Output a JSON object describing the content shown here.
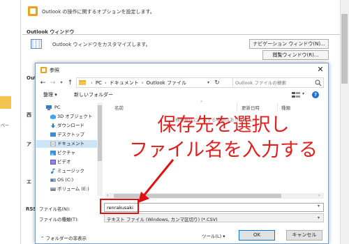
{
  "background": {
    "header_text": "Outlook の操作に関するオプションを設定します。",
    "section_title": "Outlook ウィンドウ",
    "customize_text": "Outlook ウィンドウをカスタマイズします。",
    "nav_window_button": "ナビゲーション ウィンドウ(N)...",
    "reading_window_button": "閲覧ウィンドウ(R)...",
    "sidebar_text": "ベー",
    "side_labels": [
      "Out",
      "西",
      "ア",
      "エ",
      "RSS"
    ]
  },
  "dialog": {
    "title": "参照",
    "close_glyph": "✕",
    "breadcrumbs": [
      "PC",
      "ドキュメント",
      "Outlook ファイル"
    ],
    "breadcrumb_sep": "›",
    "search_placeholder": "Outlook ファイルの検索",
    "organize_label": "整理 ▾",
    "new_folder_label": "新しいフォルダー",
    "nav_items": [
      {
        "label": "PC",
        "icon": "pc-icon"
      },
      {
        "label": "3D オブジェクト",
        "icon": "3d-objects-icon"
      },
      {
        "label": "ダウンロード",
        "icon": "download-icon"
      },
      {
        "label": "デスクトップ",
        "icon": "desktop-icon"
      },
      {
        "label": "ドキュメント",
        "icon": "documents-icon",
        "selected": true
      },
      {
        "label": "ピクチャ",
        "icon": "pictures-icon"
      },
      {
        "label": "ビデオ",
        "icon": "video-icon"
      },
      {
        "label": "ミュージック",
        "icon": "music-icon"
      },
      {
        "label": "OS (C:)",
        "icon": "drive-icon"
      },
      {
        "label": "ボリューム (E:)",
        "icon": "drive-icon"
      }
    ],
    "columns": {
      "name": "名前",
      "date": "更新日時",
      "type": "種類"
    },
    "empty_message": "検索条件に一致する項目はありません。",
    "filename_label": "ファイル名(N):",
    "filename_value": "renrakusaki",
    "filetype_label": "ファイルの種類(T):",
    "filetype_value": "テキスト ファイル (Windows, カンマ区切り) (*.CSV)",
    "hide_folders_label": "フォルダーの非表示",
    "tools_label": "ツール(L) ▾",
    "ok_label": "OK",
    "cancel_label": "キャンセル"
  },
  "annotation": {
    "line1": "保存先を選択し",
    "line2": "ファイル名を入力する",
    "color": "#e02020"
  }
}
